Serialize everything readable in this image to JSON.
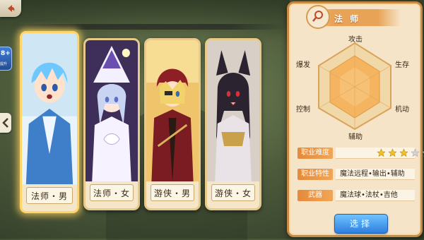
{
  "back_button": {
    "icon": "back-arrow-icon"
  },
  "side_badge": {
    "value": "8+",
    "caption": "提升"
  },
  "side_arrow": {
    "icon": "chevron-left-icon"
  },
  "cards": [
    {
      "label": "法师・男",
      "selected": true
    },
    {
      "label": "法师・女",
      "selected": false
    },
    {
      "label": "游侠・男",
      "selected": false
    },
    {
      "label": "游侠・女",
      "selected": false
    }
  ],
  "panel": {
    "class_title": "法 师",
    "emblem_icon": "magnifier-staff-icon",
    "radar": {
      "labels": {
        "top": "攻击",
        "upper_right": "生存",
        "lower_right": "机动",
        "bottom": "辅助",
        "lower_left": "控制",
        "upper_left": "爆发"
      }
    },
    "difficulty": {
      "key": "职业难度",
      "stars_filled": 3,
      "stars_total": 5
    },
    "trait": {
      "key": "职业特性",
      "value": "魔法远程•输出•辅助"
    },
    "weapon": {
      "key": "武器",
      "value": "魔法球•法杖•吉他"
    },
    "select_button": "选择"
  },
  "colors": {
    "accent_orange": "#e8a356",
    "select_blue": "#2d7fde",
    "star_gold": "#f2c21f"
  }
}
